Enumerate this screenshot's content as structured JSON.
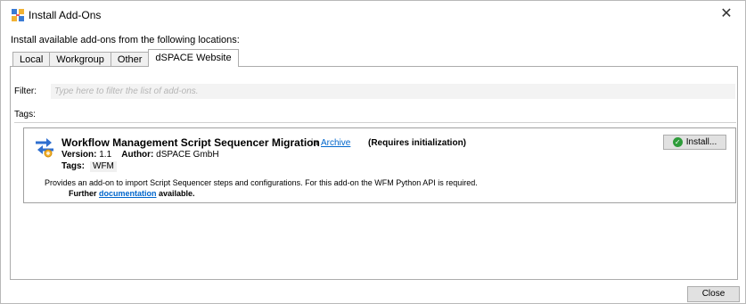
{
  "window": {
    "title": "Install Add-Ons",
    "close_glyph": "✕"
  },
  "intro": "Install available add-ons from the following locations:",
  "tabs": [
    {
      "label": "Local",
      "active": false
    },
    {
      "label": "Workgroup",
      "active": false
    },
    {
      "label": "Other",
      "active": false
    },
    {
      "label": "dSPACE Website",
      "active": true
    }
  ],
  "filter": {
    "label": "Filter:",
    "placeholder": "Type here to filter the list of add-ons."
  },
  "tags_label": "Tags:",
  "addon": {
    "icon": "migration-arrows-icon",
    "name": "Workflow Management Script Sequencer Migration",
    "in_text": "in",
    "location": "Archive",
    "requires": "(Requires initialization)",
    "version_label": "Version:",
    "version": "1.1",
    "author_label": "Author:",
    "author": "dSPACE GmbH",
    "tags_label": "Tags:",
    "tag": "WFM",
    "description": "Provides an add-on to import Script Sequencer steps and configurations. For this add-on the WFM Python API is required.",
    "further_prefix": "Further",
    "documentation_link": "documentation",
    "further_suffix": "available.",
    "install_label": "Install..."
  },
  "close_button": "Close",
  "colors": {
    "link": "#0066cc",
    "install_check": "#2e9c3a"
  }
}
